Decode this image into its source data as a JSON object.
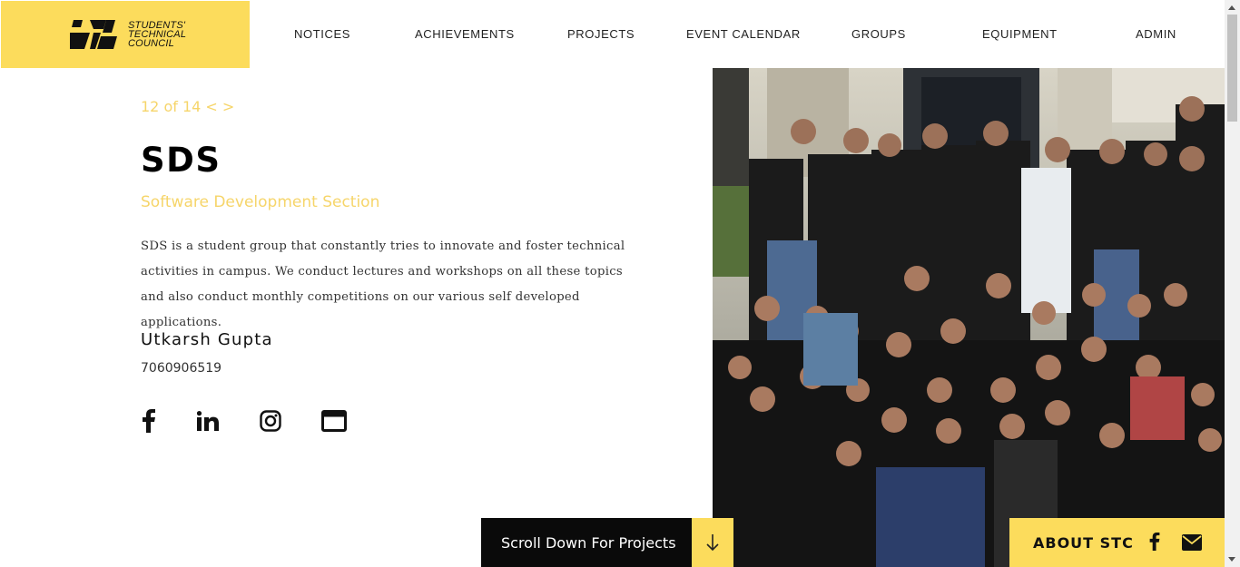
{
  "logo": {
    "line1": "STUDENTS'",
    "line2": "TECHNICAL",
    "line3": "COUNCIL"
  },
  "nav": [
    {
      "label": "NOTICES"
    },
    {
      "label": "ACHIEVEMENTS"
    },
    {
      "label": "PROJECTS"
    },
    {
      "label": "EVENT CALENDAR"
    },
    {
      "label": "GROUPS"
    },
    {
      "label": "EQUIPMENT"
    },
    {
      "label": "ADMIN"
    }
  ],
  "group": {
    "pager": "12 of 14",
    "prev": "<",
    "next": ">",
    "title": "SDS",
    "subtitle": "Software Development Section",
    "description": "SDS is a student group that constantly tries to innovate and foster technical activities in campus. We conduct lectures and workshops on all these topics and also conduct monthly competitions on our various self developed applications.",
    "contact_name": "Utkarsh Gupta",
    "contact_phone": "7060906519"
  },
  "social_icons": [
    "facebook-icon",
    "linkedin-icon",
    "instagram-icon",
    "website-icon"
  ],
  "footer": {
    "scroll_label": "Scroll Down For Projects",
    "about_label": "ABOUT STC"
  },
  "colors": {
    "accent": "#fcdc5c",
    "accent_text": "#f6d56a",
    "dark": "#0a0a0a"
  }
}
